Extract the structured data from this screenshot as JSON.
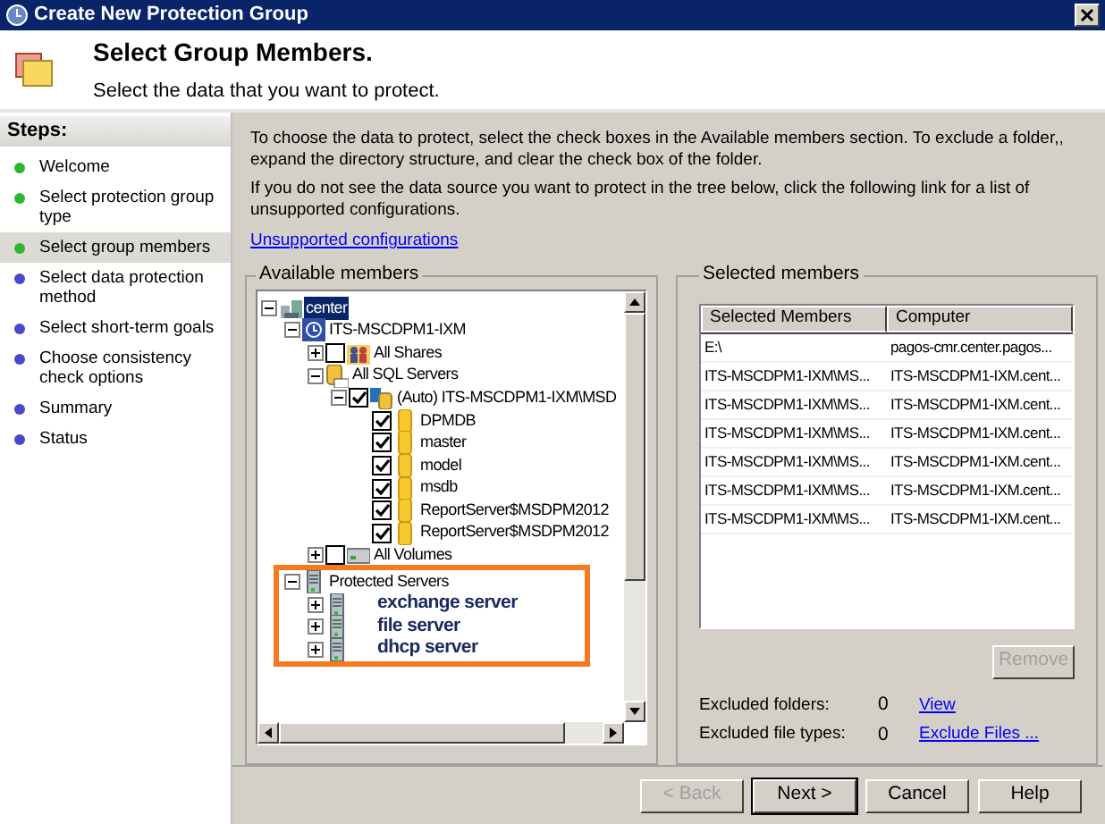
{
  "window": {
    "title": "Create New Protection Group"
  },
  "header": {
    "title": "Select Group Members.",
    "subtitle": "Select the data that you want to protect."
  },
  "steps": {
    "heading": "Steps:",
    "items": [
      {
        "label": "Welcome",
        "color": "#2fb52f",
        "selected": false
      },
      {
        "label": "Select protection group type",
        "color": "#2fb52f",
        "selected": false
      },
      {
        "label": "Select group members",
        "color": "#2fb52f",
        "selected": true
      },
      {
        "label": "Select data protection method",
        "color": "#4848c8",
        "selected": false
      },
      {
        "label": "Select short-term goals",
        "color": "#4848c8",
        "selected": false
      },
      {
        "label": "Choose consistency check options",
        "color": "#4848c8",
        "selected": false
      },
      {
        "label": "Summary",
        "color": "#4848c8",
        "selected": false
      },
      {
        "label": "Status",
        "color": "#4848c8",
        "selected": false
      }
    ]
  },
  "instructions": [
    "To choose the data to protect, select the check boxes in the Available members section. To exclude a folder,, expand the directory structure, and clear the check box of the folder.",
    "If you do not see the data source you want to protect in the tree below, click the following link for a list of unsupported configurations."
  ],
  "unsupported_link": "Unsupported configurations",
  "available_members": {
    "title": "Available members",
    "tree": [
      {
        "label": "center",
        "kind": "domain",
        "expanded": true,
        "selected": true,
        "children": [
          {
            "label": "ITS-MSCDPM1-IXM",
            "kind": "computer",
            "expanded": true,
            "selected": false,
            "children": [
              {
                "label": "All Shares",
                "kind": "shares",
                "expanded": false,
                "checked": false,
                "selected": false
              },
              {
                "label": "All SQL Servers",
                "kind": "sql",
                "expanded": true,
                "selected": false,
                "children": [
                  {
                    "label": "(Auto) ITS-MSCDPM1-IXM\\MSD",
                    "kind": "instance",
                    "expanded": true,
                    "checked": true,
                    "selected": false,
                    "children": [
                      {
                        "label": "DPMDB",
                        "kind": "database",
                        "checked": true,
                        "selected": false
                      },
                      {
                        "label": "master",
                        "kind": "database",
                        "checked": true,
                        "selected": false
                      },
                      {
                        "label": "model",
                        "kind": "database",
                        "checked": true,
                        "selected": false
                      },
                      {
                        "label": "msdb",
                        "kind": "database",
                        "checked": true,
                        "selected": false
                      },
                      {
                        "label": "ReportServer$MSDPM2012",
                        "kind": "database",
                        "checked": true,
                        "selected": false
                      },
                      {
                        "label": "ReportServer$MSDPM2012",
                        "kind": "database",
                        "checked": true,
                        "selected": false
                      }
                    ]
                  }
                ]
              },
              {
                "label": "All Volumes",
                "kind": "volumes",
                "expanded": false,
                "checked": false,
                "selected": false
              }
            ]
          },
          {
            "label": "Protected Servers",
            "kind": "server",
            "expanded": true,
            "selected": false,
            "highlighted": true,
            "children": [
              {
                "label": "exchange server",
                "kind": "server",
                "expanded": false,
                "bold": true,
                "selected": false
              },
              {
                "label": "file server",
                "kind": "server",
                "expanded": false,
                "bold": true,
                "selected": false
              },
              {
                "label": "dhcp server",
                "kind": "server",
                "expanded": false,
                "bold": true,
                "selected": false
              }
            ]
          }
        ]
      }
    ]
  },
  "selected_members": {
    "title": "Selected members",
    "columns": [
      "Selected Members",
      "Computer"
    ],
    "rows": [
      [
        "E:\\",
        "pagos-cmr.center.pagos..."
      ],
      [
        "ITS-MSCDPM1-IXM\\MS...",
        "ITS-MSCDPM1-IXM.cent..."
      ],
      [
        "ITS-MSCDPM1-IXM\\MS...",
        "ITS-MSCDPM1-IXM.cent..."
      ],
      [
        "ITS-MSCDPM1-IXM\\MS...",
        "ITS-MSCDPM1-IXM.cent..."
      ],
      [
        "ITS-MSCDPM1-IXM\\MS...",
        "ITS-MSCDPM1-IXM.cent..."
      ],
      [
        "ITS-MSCDPM1-IXM\\MS...",
        "ITS-MSCDPM1-IXM.cent..."
      ],
      [
        "ITS-MSCDPM1-IXM\\MS...",
        "ITS-MSCDPM1-IXM.cent..."
      ]
    ],
    "remove_button": {
      "label": "Remove",
      "disabled": true
    },
    "excluded": [
      {
        "label": "Excluded folders:",
        "count": "0",
        "link": "View"
      },
      {
        "label": "Excluded file types:",
        "count": "0",
        "link": "Exclude Files ..."
      }
    ]
  },
  "buttons": [
    {
      "label": "< Back",
      "disabled": true
    },
    {
      "label": "Next >",
      "disabled": false,
      "default": true
    },
    {
      "label": "Cancel",
      "disabled": false
    },
    {
      "label": "Help",
      "disabled": false
    }
  ]
}
